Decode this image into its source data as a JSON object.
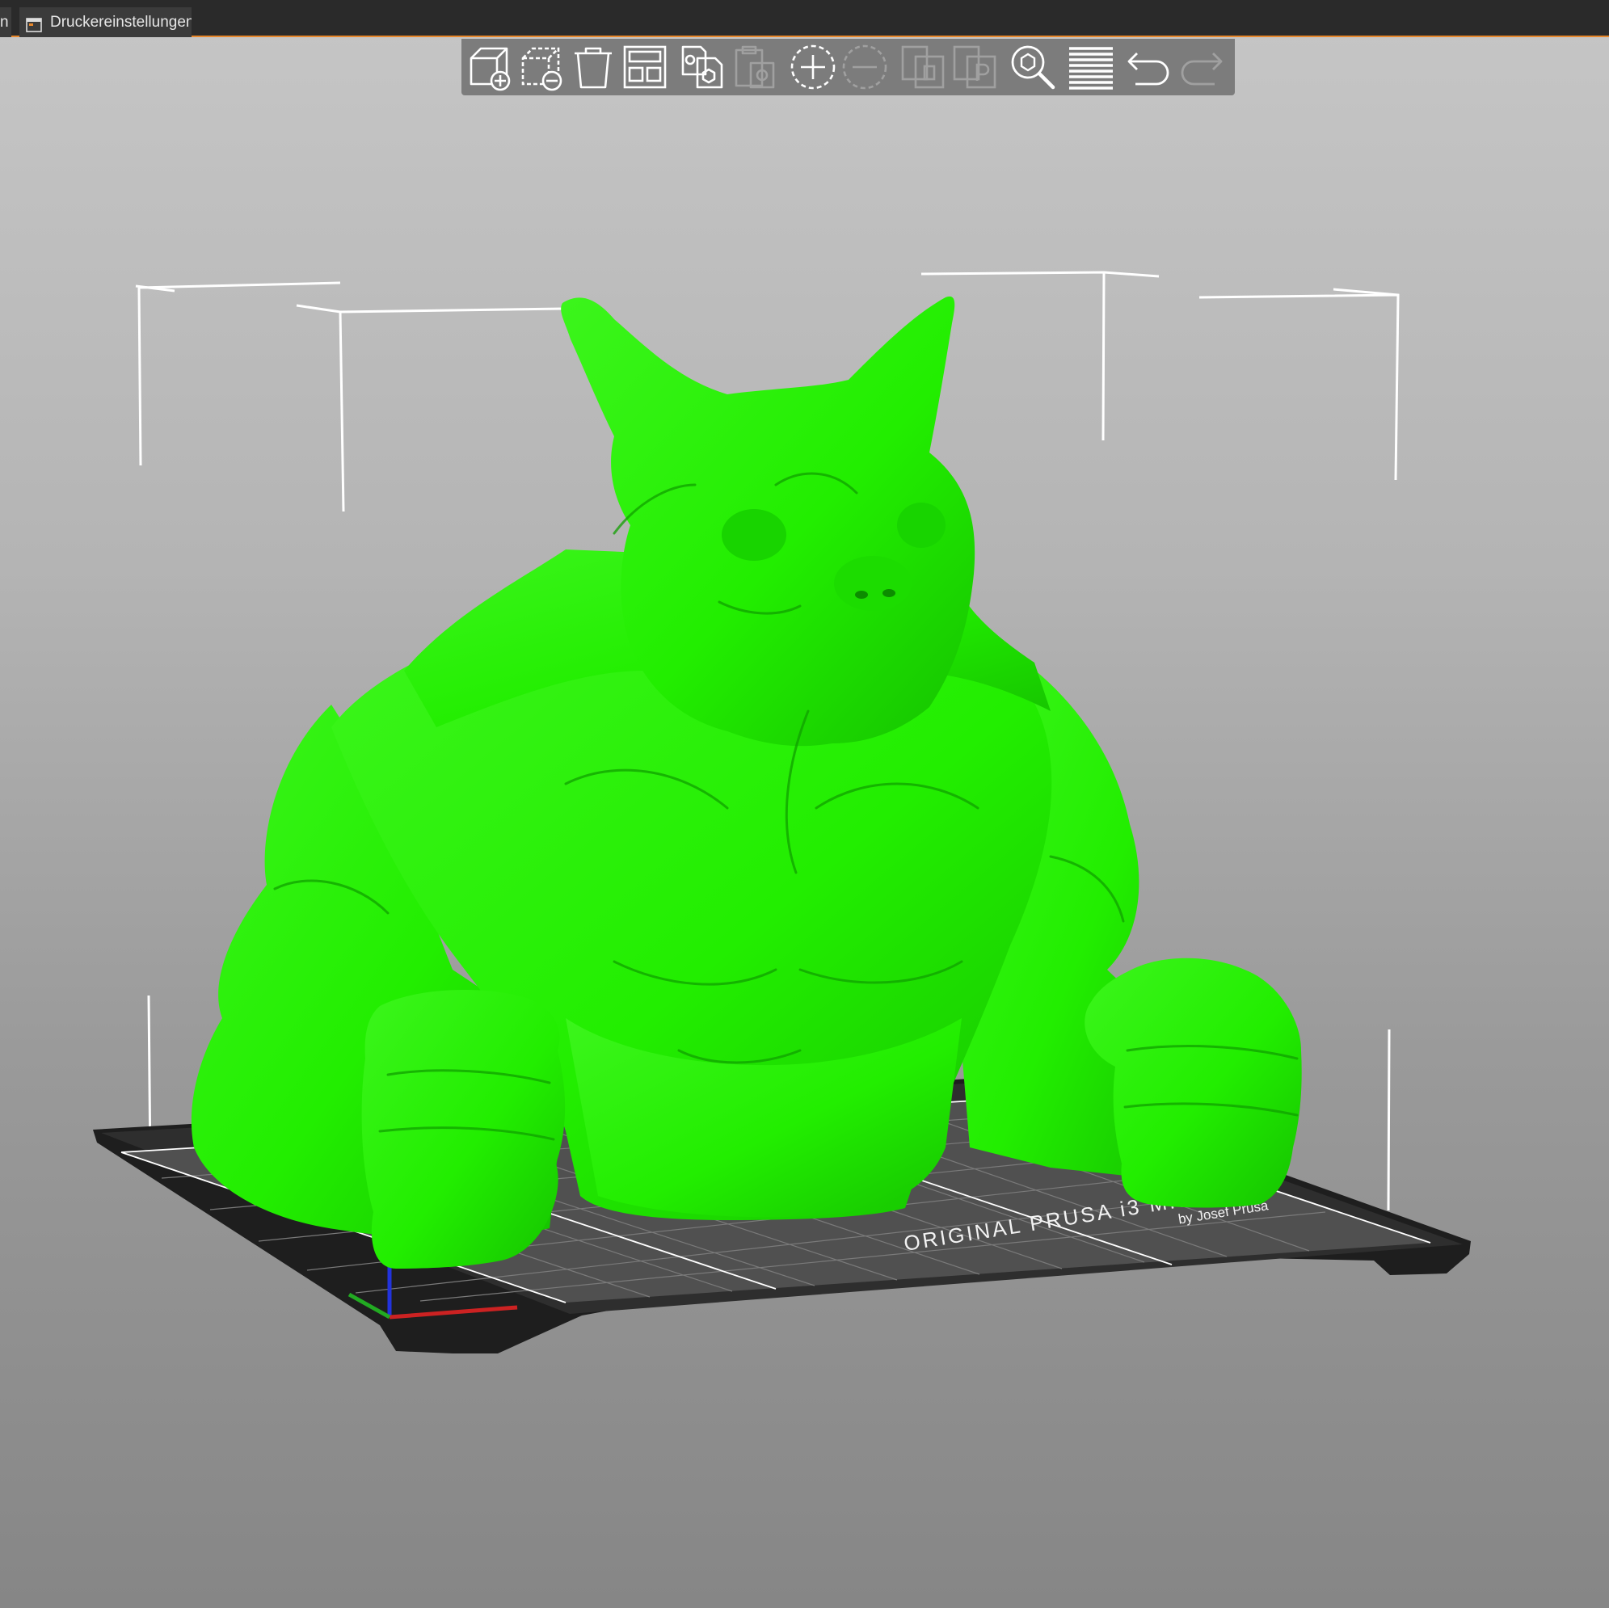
{
  "tabs": [
    {
      "label": "n",
      "icon": ""
    },
    {
      "label": "Druckereinstellungen",
      "icon": "printer-settings-icon"
    }
  ],
  "toolbar": {
    "items": [
      {
        "icon": "add-object-icon",
        "enabled": true
      },
      {
        "icon": "delete-object-icon",
        "enabled": true
      },
      {
        "icon": "delete-all-icon",
        "enabled": true
      },
      {
        "icon": "arrange-icon",
        "enabled": true
      },
      {
        "icon": "copy-icon",
        "enabled": true
      },
      {
        "icon": "paste-icon",
        "enabled": false
      },
      {
        "icon": "add-instance-icon",
        "enabled": true
      },
      {
        "icon": "remove-instance-icon",
        "enabled": false
      },
      {
        "icon": "split-objects-icon",
        "enabled": false
      },
      {
        "icon": "split-parts-icon",
        "enabled": false
      },
      {
        "icon": "search-icon",
        "enabled": true
      },
      {
        "icon": "layers-editing-icon",
        "enabled": true
      },
      {
        "icon": "undo-icon",
        "enabled": true
      },
      {
        "icon": "redo-icon",
        "enabled": false
      }
    ]
  },
  "bed": {
    "label_line1": "ORIGINAL PRUSA i3 MK3",
    "label_line2": "by Josef Prusa"
  },
  "colors": {
    "model": "#22ee00",
    "accent": "#e8882c",
    "bed": "#2c2c2c",
    "axis_x": "#cc2222",
    "axis_y": "#22aa22",
    "axis_z": "#2233dd"
  }
}
